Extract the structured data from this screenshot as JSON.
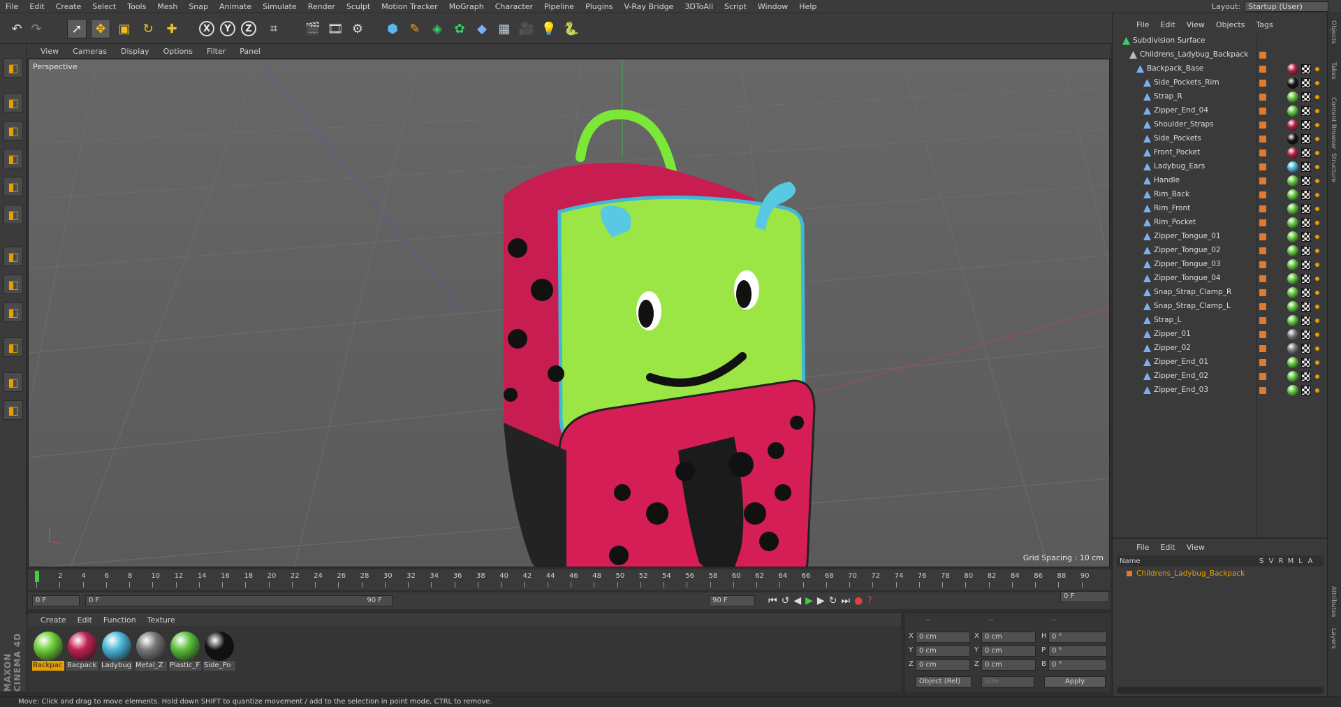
{
  "menubar": {
    "items": [
      "File",
      "Edit",
      "Create",
      "Select",
      "Tools",
      "Mesh",
      "Snap",
      "Animate",
      "Simulate",
      "Render",
      "Sculpt",
      "Motion Tracker",
      "MoGraph",
      "Character",
      "Pipeline",
      "Plugins",
      "V-Ray Bridge",
      "3DToAll",
      "Script",
      "Window",
      "Help"
    ],
    "layout_label": "Layout:",
    "layout_value": "Startup (User)"
  },
  "toolbar": {
    "icons": [
      "undo-icon",
      "redo-icon",
      "select-icon",
      "move-icon",
      "scale-icon",
      "rotate-icon",
      "transform-icon",
      "x-axis-icon",
      "y-axis-icon",
      "z-axis-icon",
      "coordinate-system-icon",
      "render-view-icon",
      "render-picture-viewer-icon",
      "edit-render-settings-icon",
      "cube-icon",
      "pen-icon",
      "subdivision-icon",
      "cloner-icon",
      "deformer-icon",
      "floor-icon",
      "camera-icon",
      "light-icon",
      "python-icon"
    ],
    "axis_labels": [
      "X",
      "Y",
      "Z"
    ]
  },
  "viewport": {
    "menu": [
      "View",
      "Cameras",
      "Display",
      "Options",
      "Filter",
      "Panel"
    ],
    "label": "Perspective",
    "grid_spacing": "Grid Spacing : 10 cm"
  },
  "timeline": {
    "ticks": [
      "0",
      "2",
      "4",
      "6",
      "8",
      "10",
      "12",
      "14",
      "16",
      "18",
      "20",
      "22",
      "24",
      "26",
      "28",
      "30",
      "32",
      "34",
      "36",
      "38",
      "40",
      "42",
      "44",
      "46",
      "48",
      "50",
      "52",
      "54",
      "56",
      "58",
      "60",
      "62",
      "64",
      "66",
      "68",
      "70",
      "72",
      "74",
      "76",
      "78",
      "80",
      "82",
      "84",
      "86",
      "88",
      "90"
    ],
    "current_frame": "0 F",
    "range_start": "0 F",
    "range_end_slider": "90 F",
    "range_end": "90 F",
    "frame_right": "0 F"
  },
  "materials": {
    "menu": [
      "Create",
      "Edit",
      "Function",
      "Texture"
    ],
    "items": [
      {
        "label": "Backpac",
        "color": "#6fcf3a"
      },
      {
        "label": "Bacpack",
        "color": "#c02050"
      },
      {
        "label": "Ladybug",
        "color": "#49b6d8"
      },
      {
        "label": "Metal_Z",
        "color": "#777777"
      },
      {
        "label": "Plastic_F",
        "color": "#59c03a"
      },
      {
        "label": "Side_Po",
        "color": "#111111"
      }
    ]
  },
  "coords": {
    "header": [
      "--",
      "--",
      "--"
    ],
    "rows": [
      {
        "a": "X",
        "av": "0 cm",
        "b": "X",
        "bv": "0 cm",
        "c": "H",
        "cv": "0 °"
      },
      {
        "a": "Y",
        "av": "0 cm",
        "b": "Y",
        "bv": "0 cm",
        "c": "P",
        "cv": "0 °"
      },
      {
        "a": "Z",
        "av": "0 cm",
        "b": "Z",
        "bv": "0 cm",
        "c": "B",
        "cv": "0 °"
      }
    ],
    "mode": "Object (Rel)",
    "size": "Size",
    "apply": "Apply"
  },
  "status": "Move: Click and drag to move elements. Hold down SHIFT to quantize movement / add to the selection in point mode, CTRL to remove.",
  "objects": {
    "menu": [
      "File",
      "Edit",
      "View",
      "Objects",
      "Tags"
    ],
    "tree": [
      {
        "name": "Subdivision Surface",
        "depth": 0,
        "tag": "none"
      },
      {
        "name": "Childrens_Ladybug_Backpack",
        "depth": 1,
        "tag": "none"
      },
      {
        "name": "Backpack_Base",
        "depth": 2,
        "tag": "#b02040"
      },
      {
        "name": "Side_Pockets_Rim",
        "depth": 3,
        "tag": "#111111"
      },
      {
        "name": "Strap_R",
        "depth": 3,
        "tag": "#5dc23a"
      },
      {
        "name": "Zipper_End_04",
        "depth": 3,
        "tag": "#5dc23a"
      },
      {
        "name": "Shoulder_Straps",
        "depth": 3,
        "tag": "#b02040"
      },
      {
        "name": "Side_Pockets",
        "depth": 3,
        "tag": "#111111"
      },
      {
        "name": "Front_Pocket",
        "depth": 3,
        "tag": "#b02040"
      },
      {
        "name": "Ladybug_Ears",
        "depth": 3,
        "tag": "#49b6d8"
      },
      {
        "name": "Handle",
        "depth": 3,
        "tag": "#5dc23a"
      },
      {
        "name": "Rim_Back",
        "depth": 3,
        "tag": "#5dc23a"
      },
      {
        "name": "Rim_Front",
        "depth": 3,
        "tag": "#5dc23a"
      },
      {
        "name": "Rim_Pocket",
        "depth": 3,
        "tag": "#5dc23a"
      },
      {
        "name": "Zipper_Tongue_01",
        "depth": 3,
        "tag": "#5dc23a"
      },
      {
        "name": "Zipper_Tongue_02",
        "depth": 3,
        "tag": "#5dc23a"
      },
      {
        "name": "Zipper_Tongue_03",
        "depth": 3,
        "tag": "#5dc23a"
      },
      {
        "name": "Zipper_Tongue_04",
        "depth": 3,
        "tag": "#5dc23a"
      },
      {
        "name": "Snap_Strap_Clamp_R",
        "depth": 3,
        "tag": "#5dc23a"
      },
      {
        "name": "Snap_Strap_Clamp_L",
        "depth": 3,
        "tag": "#5dc23a"
      },
      {
        "name": "Strap_L",
        "depth": 3,
        "tag": "#5dc23a"
      },
      {
        "name": "Zipper_01",
        "depth": 3,
        "tag": "#777777"
      },
      {
        "name": "Zipper_02",
        "depth": 3,
        "tag": "#777777"
      },
      {
        "name": "Zipper_End_01",
        "depth": 3,
        "tag": "#5dc23a"
      },
      {
        "name": "Zipper_End_02",
        "depth": 3,
        "tag": "#5dc23a"
      },
      {
        "name": "Zipper_End_03",
        "depth": 3,
        "tag": "#5dc23a"
      }
    ]
  },
  "layers": {
    "menu": [
      "File",
      "Edit",
      "View"
    ],
    "headers": [
      "Name",
      "S",
      "V",
      "R",
      "M",
      "L",
      "A"
    ],
    "item": "Childrens_Ladybug_Backpack"
  },
  "side_tabs": [
    "Objects",
    "Takes",
    "Content Browser",
    "Structure",
    "Attributes",
    "Layers"
  ],
  "brand": "MAXON CINEMA 4D",
  "colors": {
    "accent": "#e5a000",
    "object_orange": "#e07a30",
    "layer_name": "#e5a000"
  }
}
